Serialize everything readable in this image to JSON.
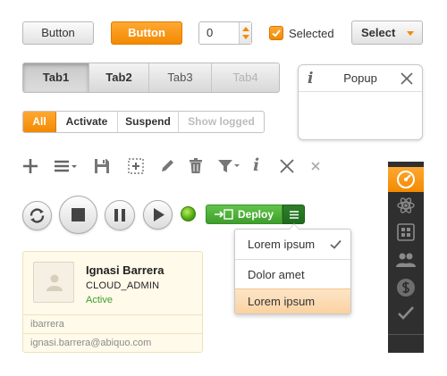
{
  "row1": {
    "button_gray": "Button",
    "button_orange": "Button",
    "spinner_value": "0",
    "checkbox_label": "Selected",
    "checkbox_checked": true,
    "select_label": "Select"
  },
  "tabs": [
    "Tab1",
    "Tab2",
    "Tab3",
    "Tab4"
  ],
  "popup": {
    "icon": "i",
    "title": "Popup"
  },
  "segmented": [
    "All",
    "Activate",
    "Suspend",
    "Show logged"
  ],
  "toolbar_icons": [
    "plus-icon",
    "list-icon",
    "save-icon",
    "add-select-icon",
    "pencil-icon",
    "trash-icon",
    "filter-icon",
    "info-icon",
    "close-icon",
    "small-close-icon"
  ],
  "info_glyph": "i",
  "deploy": {
    "label": "Deploy"
  },
  "dropdown": {
    "items": [
      {
        "label": "Lorem ipsum",
        "checked": true
      },
      {
        "label": "Dolor amet"
      },
      {
        "label": "Lorem ipsum",
        "highlighted": true
      }
    ]
  },
  "sidebar_icons": [
    "dashboard-icon",
    "atom-icon",
    "grid-icon",
    "users-icon",
    "dollar-icon",
    "check-icon"
  ],
  "user_card": {
    "name": "Ignasi Barrera",
    "role": "CLOUD_ADMIN",
    "status": "Active",
    "username": "ibarrera",
    "email": "ignasi.barrera@abiquo.com"
  },
  "colors": {
    "accent": "#f28a00",
    "green": "#3f9e2c",
    "sidebar": "#2f2f2f"
  }
}
